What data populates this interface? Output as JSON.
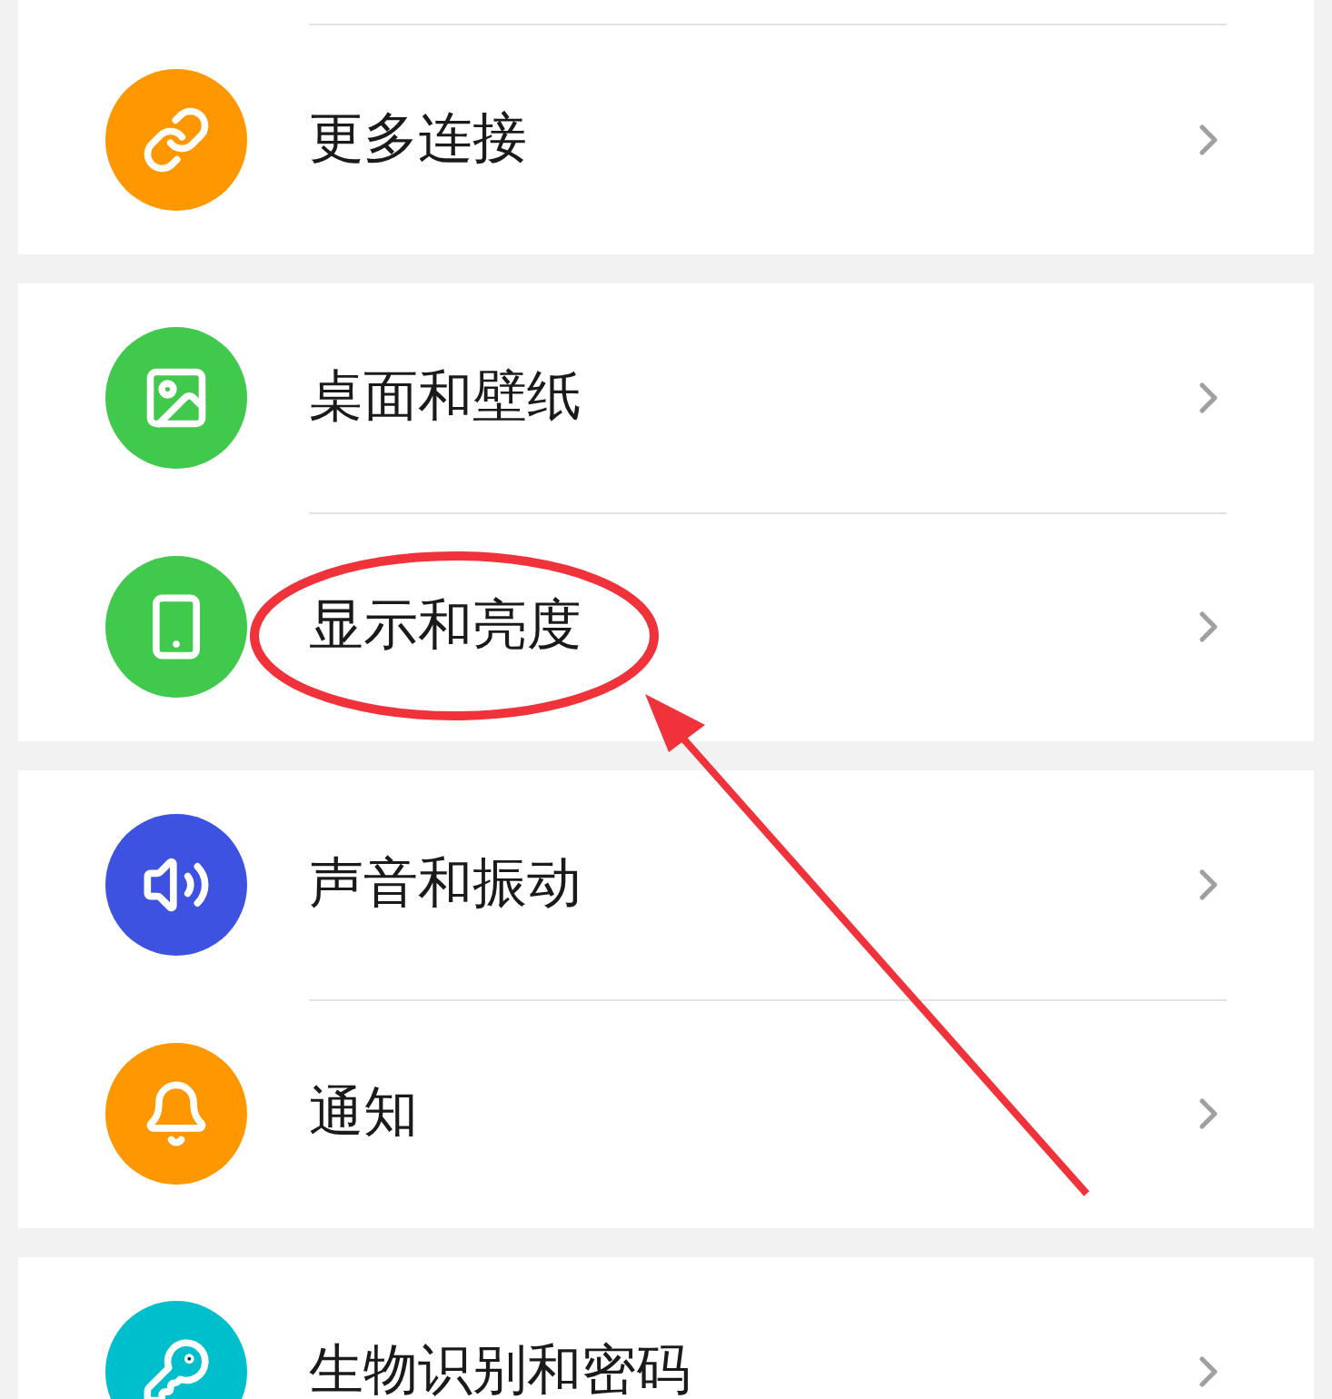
{
  "groups": [
    {
      "items": [
        {
          "label": "更多连接",
          "color": "#ff9800"
        }
      ]
    },
    {
      "items": [
        {
          "label": "桌面和壁纸",
          "color": "#40c94c"
        },
        {
          "label": "显示和亮度",
          "color": "#40c94c"
        }
      ]
    },
    {
      "items": [
        {
          "label": "声音和振动",
          "color": "#3d52e0"
        },
        {
          "label": "通知",
          "color": "#ff9800"
        }
      ]
    },
    {
      "items": [
        {
          "label": "生物识别和密码",
          "color": "#00bfcc"
        }
      ]
    }
  ]
}
